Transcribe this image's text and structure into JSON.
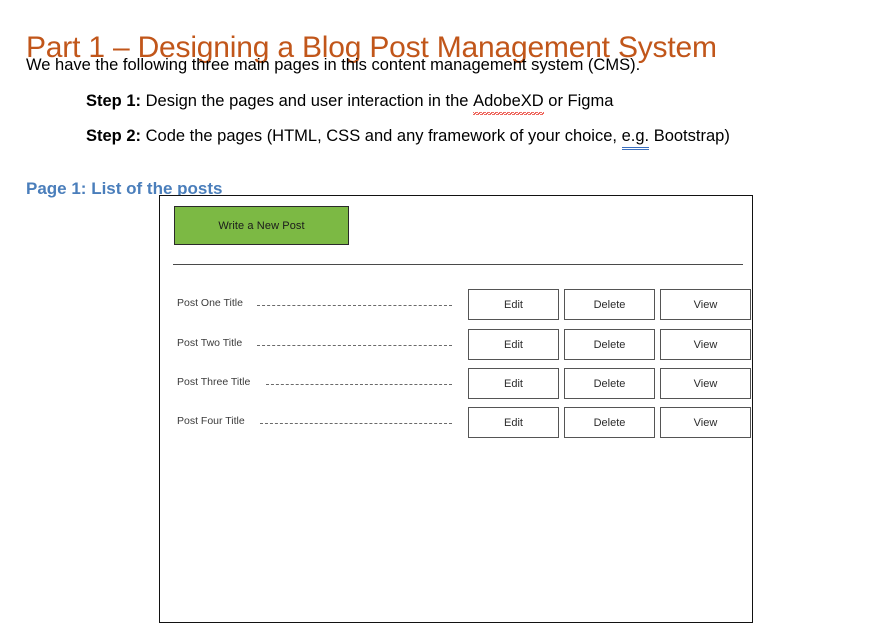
{
  "document": {
    "title": "Part 1 – Designing a Blog Post Management System",
    "intro": "We have the following three main pages in this content management system (CMS).",
    "steps": [
      {
        "label": "Step 1:",
        "text_before": " Design the pages and user interaction in the ",
        "flagged_word": "AdobeXD",
        "text_after": " or Figma"
      },
      {
        "label": "Step 2:",
        "text_before": " Code the pages (HTML, CSS and any framework of your choice, ",
        "flagged_word": "e.g.",
        "text_after": " Bootstrap)"
      }
    ],
    "page_heading": "Page 1: List of the posts"
  },
  "wireframe": {
    "new_post_button": "Write a New Post",
    "posts": [
      {
        "title": "Post One Title",
        "actions": [
          "Edit",
          "Delete",
          "View"
        ]
      },
      {
        "title": "Post Two Title",
        "actions": [
          "Edit",
          "Delete",
          "View"
        ]
      },
      {
        "title": "Post Three Title",
        "actions": [
          "Edit",
          "Delete",
          "View"
        ]
      },
      {
        "title": "Post Four Title",
        "actions": [
          "Edit",
          "Delete",
          "View"
        ]
      }
    ]
  },
  "colors": {
    "title_orange": "#C1561A",
    "heading_blue": "#4A7EBB",
    "button_green": "#7CB944",
    "border_dark": "#121212",
    "spellcheck_red": "#E8352A",
    "grammar_blue": "#3A6FBE"
  }
}
